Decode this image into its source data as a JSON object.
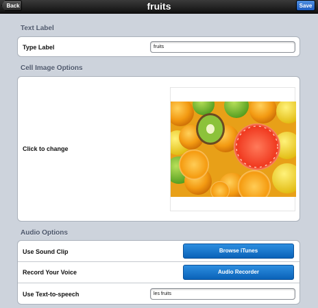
{
  "navbar": {
    "title": "fruits",
    "back_label": "Back",
    "save_label": "Save"
  },
  "text_label_section": {
    "header": "Text Label",
    "type_label": "Type Label",
    "type_label_value": "fruits"
  },
  "cell_image_section": {
    "header": "Cell Image Options",
    "click_to_change": "Click to change",
    "image_icon": "fruit-photo"
  },
  "audio_section": {
    "header": "Audio Options",
    "sound_clip_label": "Use Sound Clip",
    "browse_itunes_label": "Browse iTunes",
    "record_voice_label": "Record Your Voice",
    "audio_recorder_label": "Audio Recorder",
    "tts_label": "Use Text-to-speech",
    "tts_value": "les fruits"
  },
  "colors": {
    "navbar": "#1a1a1a",
    "save_button": "#2a6fd0",
    "action_button": "#1a78cf",
    "background": "#cdd3dc"
  }
}
